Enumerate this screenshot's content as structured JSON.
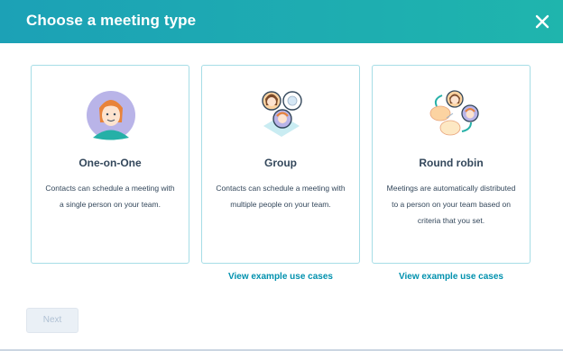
{
  "dialog": {
    "title": "Choose a meeting type",
    "close_icon": "close-icon"
  },
  "cards": [
    {
      "title": "One-on-One",
      "description": "Contacts can schedule a meeting with a single person on your team.",
      "illustration": "single-person-icon"
    },
    {
      "title": "Group",
      "description": "Contacts can schedule a meeting with multiple people on your team.",
      "illustration": "group-people-icon"
    },
    {
      "title": "Round robin",
      "description": "Meetings are automatically distributed to a person on your team based on criteria that you set.",
      "illustration": "round-robin-icon"
    }
  ],
  "links": {
    "group_examples": "View example use cases",
    "round_robin_examples": "View example use cases"
  },
  "footer": {
    "next_label": "Next"
  },
  "colors": {
    "header_start": "#1ca1b6",
    "header_end": "#1fb5ad",
    "card_border": "#a6dde6",
    "link": "#0091ae",
    "text": "#33475b"
  }
}
